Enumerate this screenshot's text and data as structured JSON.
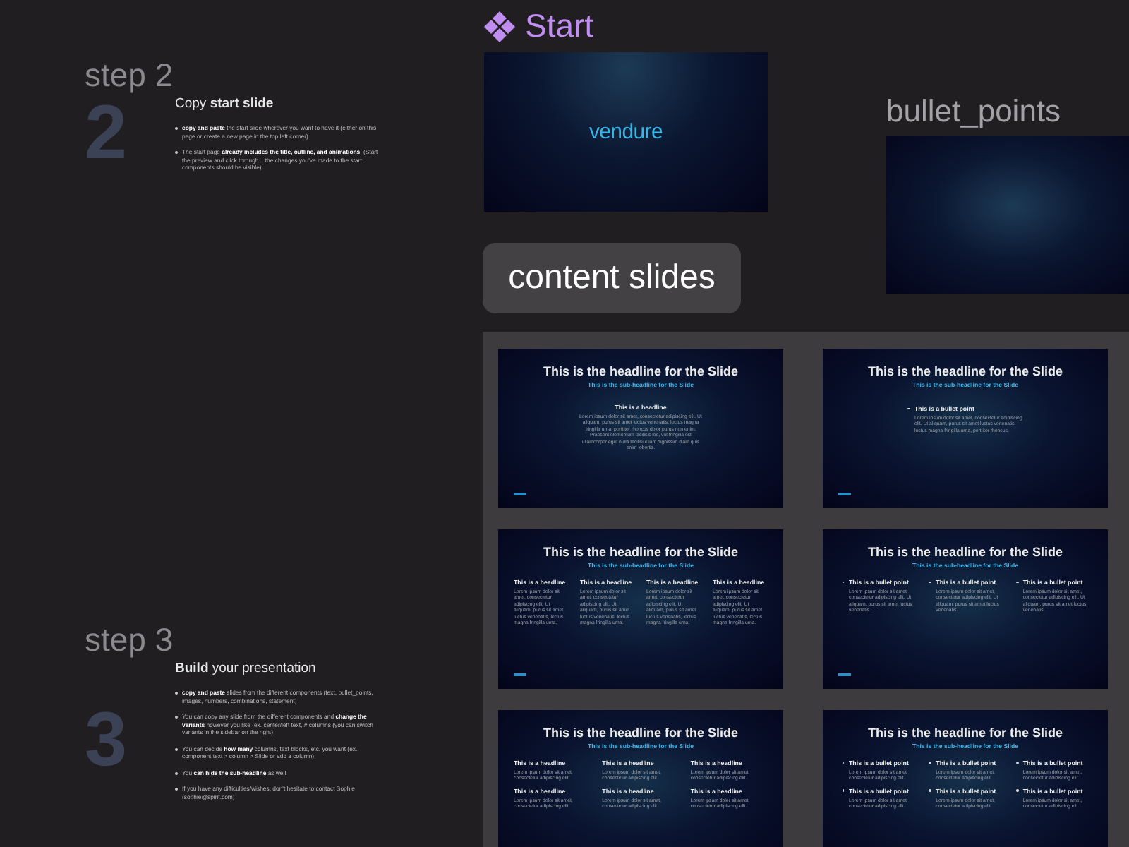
{
  "steps": [
    {
      "label": "step 2",
      "number": "2",
      "title": "Copy **start slide**",
      "bullets": [
        "**copy and paste** the start slide wherever you want to have it (either on this page or create a new page in the top left corner)",
        "The start page **already includes the title, outline, and animations**. (Start the preview and click through... the changes you've made to the start components should be visible)"
      ]
    },
    {
      "label": "step 3",
      "number": "3",
      "title": "**Build** your presentation",
      "bullets": [
        "**copy and paste** slides from the different components (text, bullet_points, images, numbers, combinations, statement)",
        "You can copy any slide from the different components and **change the variants** however you like (ex. center/left text, # columns (you can switch variants in the sidebar on the right)",
        "You can decide **how many** columns, text blocks, etc. you want (ex. component text > column > Slide or add a column)",
        "You **can hide the sub-headline** as well",
        "If you have any difficulties/wishes, don't hesitate to contact Sophie (sophie@spirit.com)"
      ]
    }
  ],
  "start": {
    "title": "Start",
    "logo": "vendure"
  },
  "bullet_points": {
    "title": "bullet_points"
  },
  "section": {
    "label": "content slides"
  },
  "slides": [
    {
      "kind": "single",
      "headline": "This is the headline for the Slide",
      "subheadline": "This is the sub-headline for the Slide",
      "items": [
        {
          "title": "This is a headline",
          "body": "Lorem ipsum dolor sit amet, consectetur adipiscing elit. Ut aliquam, purus sit amet luctus venenatis, lectus magna fringilla urna, porttitor rhoncus dolor purus non enim. Praesent elementum facilisis leo, vel fringilla est ullamcorper eget nulla facilisi etiam dignissim diam quis enim lobortis."
        }
      ]
    },
    {
      "kind": "bullets",
      "headline": "This is the headline for the Slide",
      "subheadline": "This is the sub-headline for the Slide",
      "items": [
        {
          "title": "This is a bullet point",
          "body": "Lorem ipsum dolor sit amet, consectetur adipiscing elit. Ut aliquam, purus sit amet luctus venenatis, lectus magna fringilla urna, porttitor rhoncus."
        }
      ]
    },
    {
      "kind": "columns",
      "headline": "This is the headline for the Slide",
      "subheadline": "This is the sub-headline for the Slide",
      "items": [
        {
          "title": "This is a headline",
          "body": "Lorem ipsum dolor sit amet, consectetur adipiscing elit. Ut aliquam, purus sit amet luctus venenatis, lectus magna fringilla urna."
        },
        {
          "title": "This is a headline",
          "body": "Lorem ipsum dolor sit amet, consectetur adipiscing elit. Ut aliquam, purus sit amet luctus venenatis, lectus magna fringilla urna."
        },
        {
          "title": "This is a headline",
          "body": "Lorem ipsum dolor sit amet, consectetur adipiscing elit. Ut aliquam, purus sit amet luctus venenatis, lectus magna fringilla urna."
        },
        {
          "title": "This is a headline",
          "body": "Lorem ipsum dolor sit amet, consectetur adipiscing elit. Ut aliquam, purus sit amet luctus venenatis, lectus magna fringilla urna."
        }
      ]
    },
    {
      "kind": "bullets",
      "headline": "This is the headline for the Slide",
      "subheadline": "This is the sub-headline for the Slide",
      "items": [
        {
          "title": "This is a bullet point",
          "body": "Lorem ipsum dolor sit amet, consectetur adipiscing elit. Ut aliquam, purus sit amet luctus venenatis."
        },
        {
          "title": "This is a bullet point",
          "body": "Lorem ipsum dolor sit amet, consectetur adipiscing elit. Ut aliquam, purus sit amet luctus venenatis."
        },
        {
          "title": "This is a bullet point",
          "body": "Lorem ipsum dolor sit amet, consectetur adipiscing elit. Ut aliquam, purus sit amet luctus venenatis."
        }
      ]
    },
    {
      "kind": "columns",
      "headline": "This is the headline for the Slide",
      "subheadline": "This is the sub-headline for the Slide",
      "items": [
        {
          "title": "This is a headline",
          "body": "Lorem ipsum dolor sit amet, consectetur adipiscing elit."
        },
        {
          "title": "This is a headline",
          "body": "Lorem ipsum dolor sit amet, consectetur adipiscing elit."
        },
        {
          "title": "This is a headline",
          "body": "Lorem ipsum dolor sit amet, consectetur adipiscing elit."
        },
        {
          "title": "This is a headline",
          "body": "Lorem ipsum dolor sit amet, consectetur adipiscing elit."
        },
        {
          "title": "This is a headline",
          "body": "Lorem ipsum dolor sit amet, consectetur adipiscing elit."
        },
        {
          "title": "This is a headline",
          "body": "Lorem ipsum dolor sit amet, consectetur adipiscing elit."
        }
      ]
    },
    {
      "kind": "bullets",
      "headline": "This is the headline for the Slide",
      "subheadline": "This is the sub-headline for the Slide",
      "items": [
        {
          "title": "This is a bullet point",
          "body": "Lorem ipsum dolor sit amet, consectetur adipiscing elit."
        },
        {
          "title": "This is a bullet point",
          "body": "Lorem ipsum dolor sit amet, consectetur adipiscing elit."
        },
        {
          "title": "This is a bullet point",
          "body": "Lorem ipsum dolor sit amet, consectetur adipiscing elit."
        },
        {
          "title": "This is a bullet point",
          "body": "Lorem ipsum dolor sit amet, consectetur adipiscing elit."
        },
        {
          "title": "This is a bullet point",
          "body": "Lorem ipsum dolor sit amet, consectetur adipiscing elit."
        },
        {
          "title": "This is a bullet point",
          "body": "Lorem ipsum dolor sit amet, consectetur adipiscing elit."
        }
      ]
    }
  ]
}
